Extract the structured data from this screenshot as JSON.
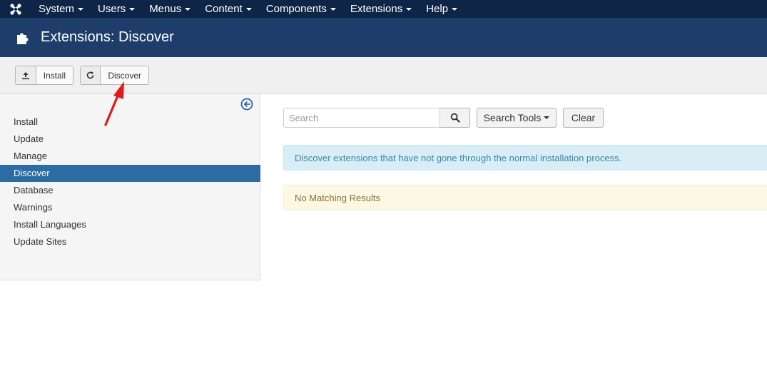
{
  "nav": {
    "logo_icon": "joomla-logo-icon",
    "items": [
      {
        "label": "System"
      },
      {
        "label": "Users"
      },
      {
        "label": "Menus"
      },
      {
        "label": "Content"
      },
      {
        "label": "Components"
      },
      {
        "label": "Extensions"
      },
      {
        "label": "Help"
      }
    ]
  },
  "header": {
    "icon": "puzzle-piece-icon",
    "title": "Extensions: Discover"
  },
  "toolbar": {
    "install_label": "Install",
    "install_icon": "upload-icon",
    "discover_label": "Discover",
    "discover_icon": "refresh-icon"
  },
  "sidebar": {
    "toggle_icon": "circle-arrow-left-icon",
    "items": [
      {
        "label": "Install"
      },
      {
        "label": "Update"
      },
      {
        "label": "Manage"
      },
      {
        "label": "Discover",
        "active": true
      },
      {
        "label": "Database"
      },
      {
        "label": "Warnings"
      },
      {
        "label": "Install Languages"
      },
      {
        "label": "Update Sites"
      }
    ]
  },
  "filters": {
    "search_placeholder": "Search",
    "search_value": "",
    "search_tools_label": "Search Tools",
    "clear_label": "Clear"
  },
  "messages": {
    "info": "Discover extensions that have not gone through the normal installation process.",
    "no_results": "No Matching Results"
  },
  "colors": {
    "navbar": "#0f2547",
    "header": "#1f3d6b",
    "sidebar_active": "#2d6ca2",
    "annotation_arrow": "#e0191c"
  }
}
